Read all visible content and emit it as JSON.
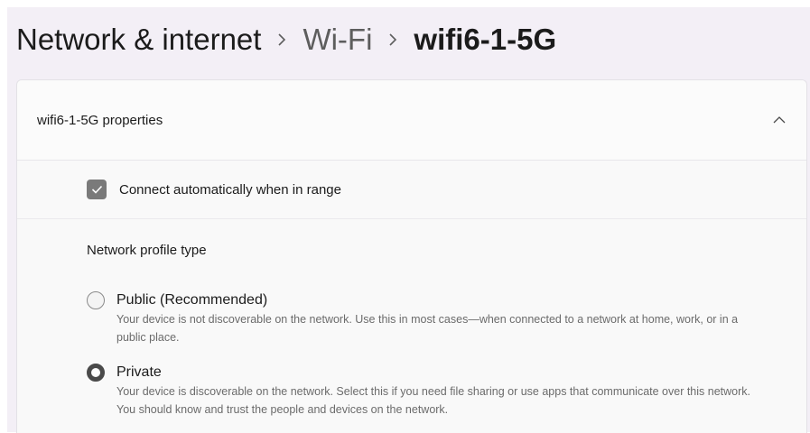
{
  "breadcrumb": {
    "level1": "Network & internet",
    "level2": "Wi-Fi",
    "current": "wifi6-1-5G"
  },
  "properties": {
    "title": "wifi6-1-5G properties",
    "connect_auto": {
      "label": "Connect automatically when in range",
      "checked": true
    },
    "profile": {
      "title": "Network profile type",
      "selected": "Private",
      "options": [
        {
          "label": "Public (Recommended)",
          "description": "Your device is not discoverable on the network. Use this in most cases—when connected to a network at home, work, or in a public place."
        },
        {
          "label": "Private",
          "description": "Your device is discoverable on the network. Select this if you need file sharing or use apps that communicate over this network. You should know and trust the people and devices on the network."
        }
      ]
    }
  },
  "icons": {
    "breadcrumb_separator": "chevron-right-icon",
    "collapse": "chevron-up-icon",
    "check": "checkmark-icon"
  },
  "colors": {
    "window_bg": "#f3eff6",
    "card_bg": "#fbfbfb",
    "checkbox_fill": "#7a7a7a"
  }
}
